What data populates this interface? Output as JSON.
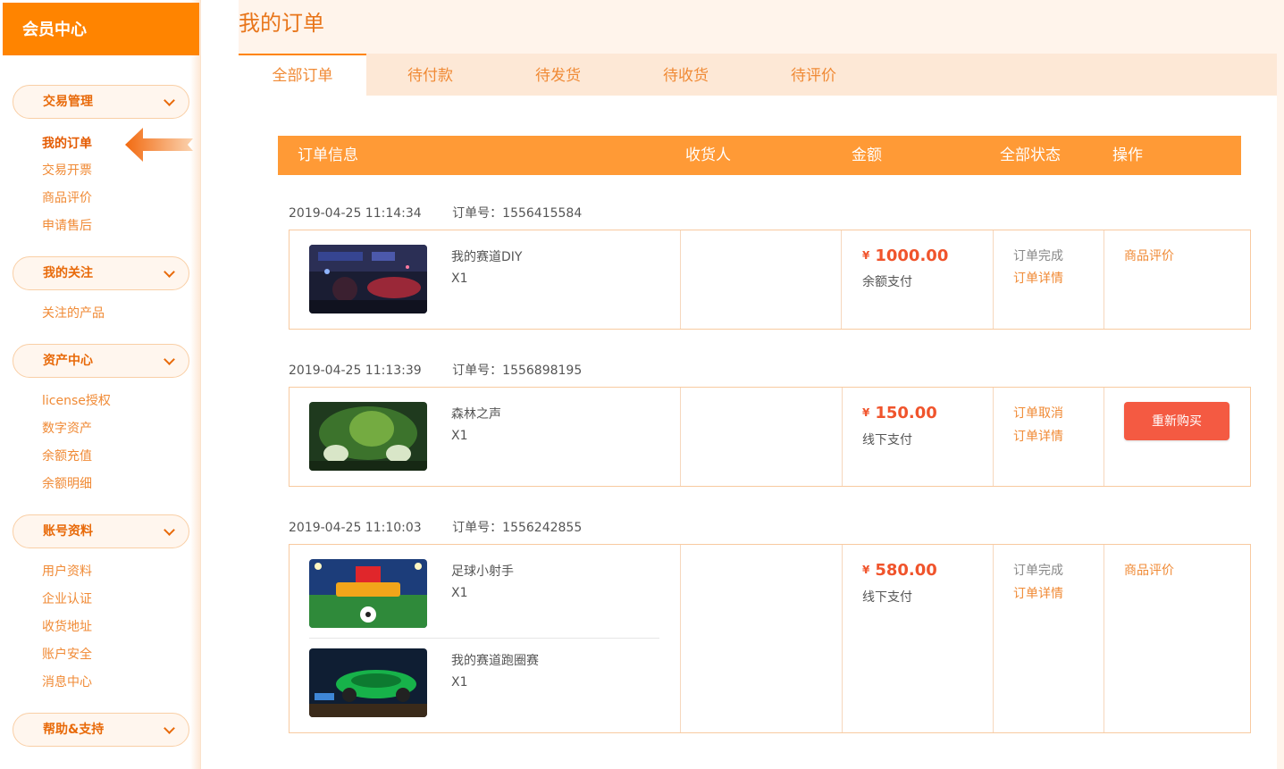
{
  "sidebar": {
    "title": "会员中心",
    "groups": [
      {
        "label": "交易管理",
        "items": [
          "我的订单",
          "交易开票",
          "商品评价",
          "申请售后"
        ]
      },
      {
        "label": "我的关注",
        "items": [
          "关注的产品"
        ]
      },
      {
        "label": "资产中心",
        "items": [
          "license授权",
          "数字资产",
          "余额充值",
          "余额明细"
        ]
      },
      {
        "label": "账号资料",
        "items": [
          "用户资料",
          "企业认证",
          "收货地址",
          "账户安全",
          "消息中心"
        ]
      },
      {
        "label": "帮助&支持",
        "items": []
      }
    ]
  },
  "page": {
    "title": "我的订单"
  },
  "tabs": [
    "全部订单",
    "待付款",
    "待发货",
    "待收货",
    "待评价"
  ],
  "table_header": {
    "info": "订单信息",
    "receiver": "收货人",
    "amount": "金额",
    "status": "全部状态",
    "action": "操作"
  },
  "order_no_label": "订单号：",
  "currency": "¥",
  "orders": [
    {
      "time": "2019-04-25 11:14:34",
      "order_no": "1556415584",
      "products": [
        {
          "name": "我的赛道DIY",
          "qty": "X1"
        }
      ],
      "price": "1000.00",
      "pay_type": "余额支付",
      "status": "订单完成",
      "detail": "订单详情",
      "action": "商品评价"
    },
    {
      "time": "2019-04-25 11:13:39",
      "order_no": "1556898195",
      "products": [
        {
          "name": "森林之声",
          "qty": "X1"
        }
      ],
      "price": "150.00",
      "pay_type": "线下支付",
      "status": "订单取消",
      "detail": "订单详情",
      "action": "重新购买"
    },
    {
      "time": "2019-04-25 11:10:03",
      "order_no": "1556242855",
      "products": [
        {
          "name": "足球小射手",
          "qty": "X1"
        },
        {
          "name": "我的赛道跑圈赛",
          "qty": "X1"
        }
      ],
      "price": "580.00",
      "pay_type": "线下支付",
      "status": "订单完成",
      "detail": "订单详情",
      "action": "商品评价"
    }
  ],
  "colors": {
    "brand": "#ff8400",
    "header_bar": "#ff9a36",
    "price": "#f0542c",
    "rebuy": "#f45a42"
  }
}
